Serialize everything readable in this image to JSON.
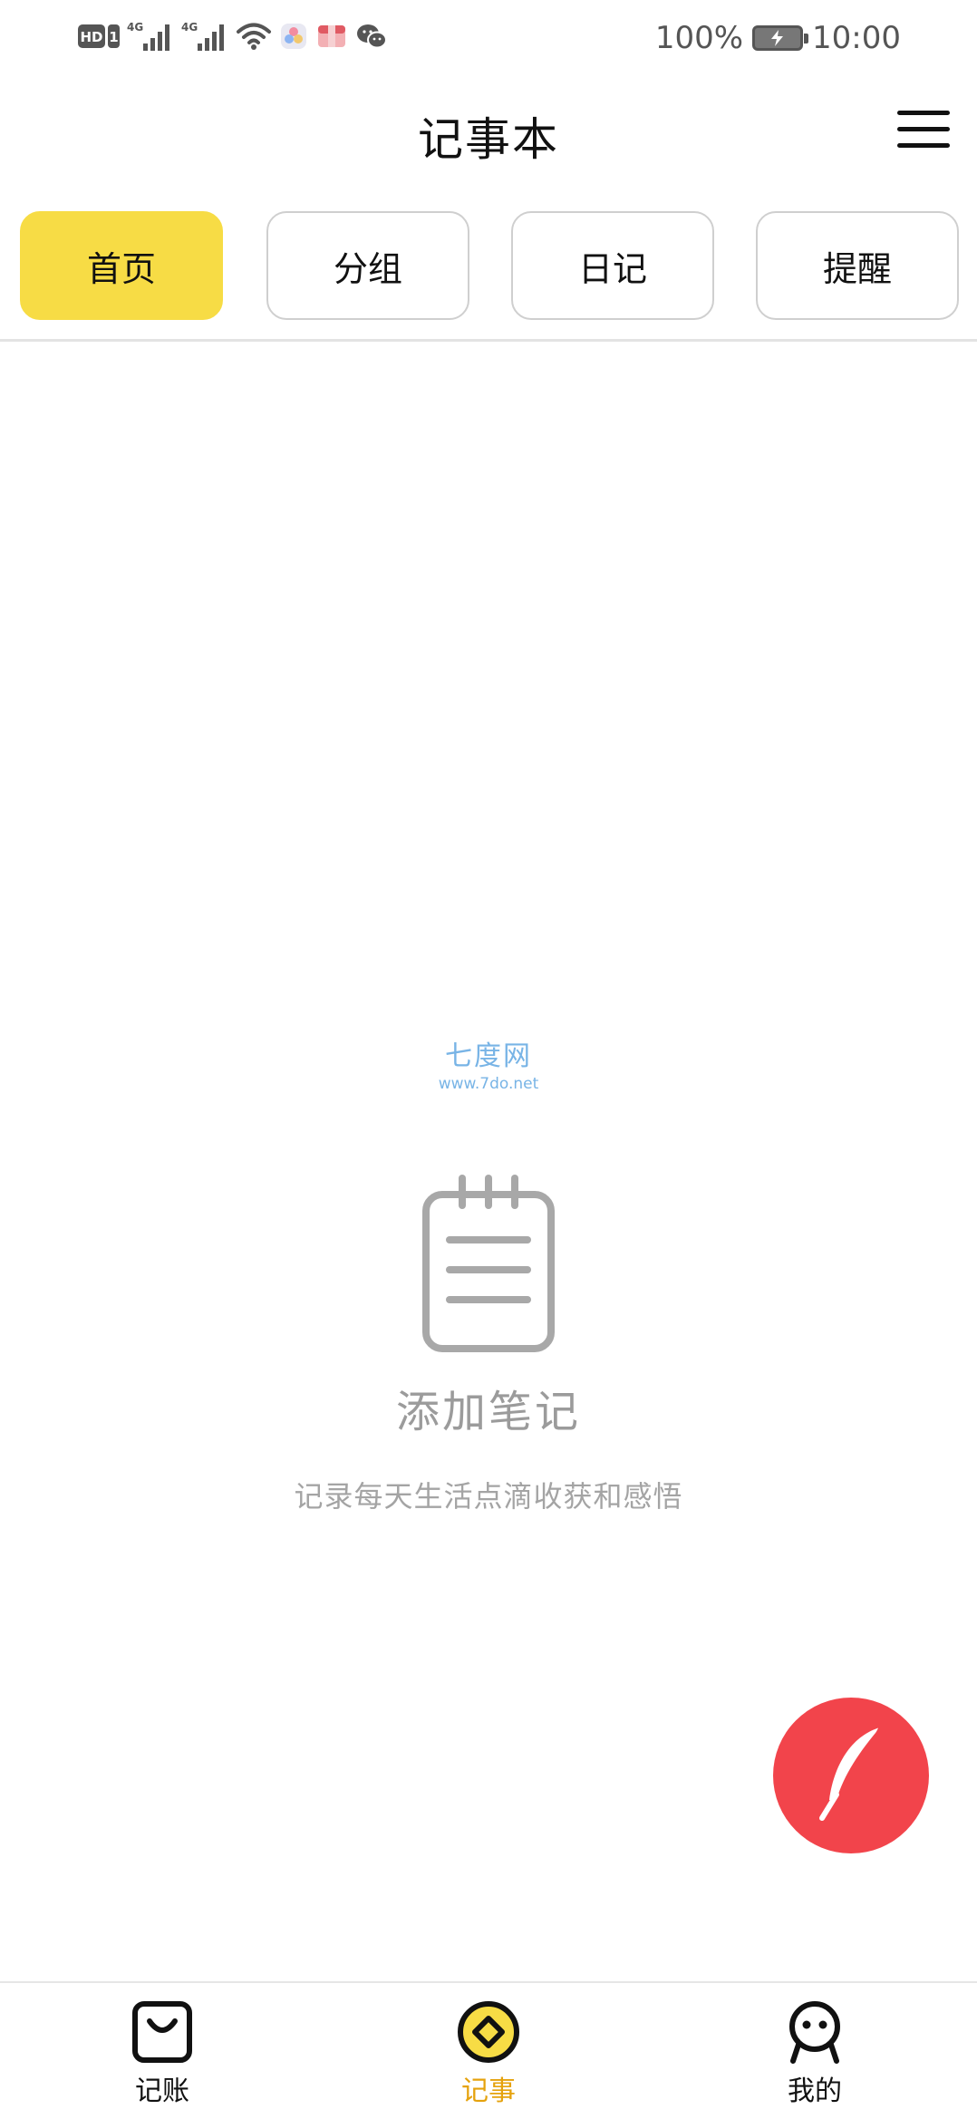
{
  "status_bar": {
    "battery_percent": "100%",
    "time": "10:00",
    "left_icons": [
      "hd-icon",
      "signal-4g-icon",
      "signal-4g-icon",
      "wifi-icon",
      "app-icon",
      "app-icon",
      "wechat-icon"
    ]
  },
  "header": {
    "title": "记事本",
    "menu_icon": "menu-icon"
  },
  "tabs": [
    {
      "label": "首页",
      "active": true
    },
    {
      "label": "分组",
      "active": false
    },
    {
      "label": "日记",
      "active": false
    },
    {
      "label": "提醒",
      "active": false
    }
  ],
  "watermark": {
    "title": "七度网",
    "subtitle": "www.7do.net"
  },
  "empty_state": {
    "icon": "notebook-icon",
    "title": "添加笔记",
    "description": "记录每天生活点滴收获和感悟"
  },
  "fab": {
    "icon": "feather-icon"
  },
  "bottom_nav": [
    {
      "label": "记账",
      "icon": "shopping-bag-icon",
      "active": false
    },
    {
      "label": "记事",
      "icon": "diamond-circle-icon",
      "active": true
    },
    {
      "label": "我的",
      "icon": "user-face-icon",
      "active": false
    }
  ],
  "colors": {
    "accent_yellow": "#f7dc45",
    "fab_red": "#f2444b",
    "active_nav_text": "#e5a20d",
    "muted_text": "#9b9b9b"
  }
}
